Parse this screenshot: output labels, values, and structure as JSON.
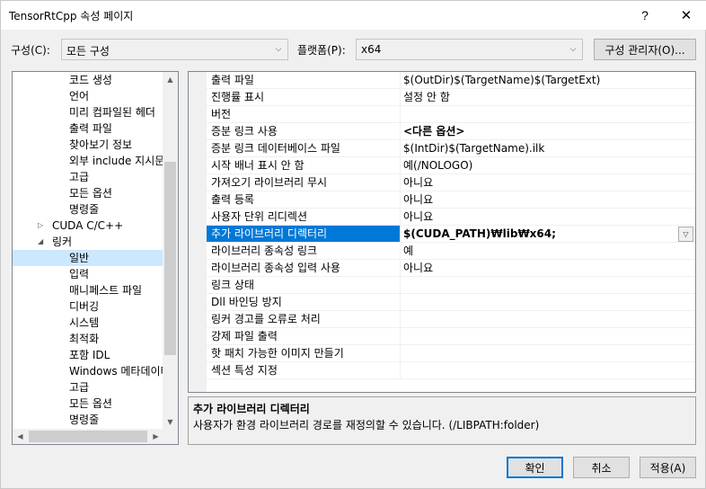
{
  "window": {
    "title": "TensorRtCpp 속성 페이지",
    "help_glyph": "?",
    "close_glyph": "✕"
  },
  "config": {
    "config_label": "구성(C):",
    "config_value": "모든 구성",
    "platform_label": "플랫폼(P):",
    "platform_value": "x64",
    "manager_button": "구성 관리자(O)..."
  },
  "tree": {
    "items": [
      {
        "label": "코드 생성"
      },
      {
        "label": "언어"
      },
      {
        "label": "미리 컴파일된 헤더"
      },
      {
        "label": "출력 파일"
      },
      {
        "label": "찾아보기 정보"
      },
      {
        "label": "외부 include 지시문"
      },
      {
        "label": "고급"
      },
      {
        "label": "모든 옵션"
      },
      {
        "label": "명령줄"
      },
      {
        "label": "CUDA C/C++"
      },
      {
        "label": "링커"
      },
      {
        "label": "일반"
      },
      {
        "label": "입력"
      },
      {
        "label": "매니페스트 파일"
      },
      {
        "label": "디버깅"
      },
      {
        "label": "시스템"
      },
      {
        "label": "최적화"
      },
      {
        "label": "포함 IDL"
      },
      {
        "label": "Windows 메타데이터"
      },
      {
        "label": "고급"
      },
      {
        "label": "모든 옵션"
      },
      {
        "label": "명령줄"
      }
    ],
    "collapsed_glyph": "▷",
    "expanded_glyph": "◢",
    "scroll_up": "▲",
    "scroll_down": "▼",
    "scroll_left": "◀",
    "scroll_right": "▶"
  },
  "grid": {
    "rows": [
      {
        "name": "출력 파일",
        "value": "$(OutDir)$(TargetName)$(TargetExt)"
      },
      {
        "name": "진행률 표시",
        "value": "설정 안 함"
      },
      {
        "name": "버전",
        "value": ""
      },
      {
        "name": "증분 링크 사용",
        "value": "<다른 옵션>"
      },
      {
        "name": "증분 링크 데이터베이스 파일",
        "value": "$(IntDir)$(TargetName).ilk"
      },
      {
        "name": "시작 배너 표시 안 함",
        "value": "예(/NOLOGO)"
      },
      {
        "name": "가져오기 라이브러리 무시",
        "value": "아니요"
      },
      {
        "name": "출력 등록",
        "value": "아니요"
      },
      {
        "name": "사용자 단위 리디렉션",
        "value": "아니요"
      },
      {
        "name": "추가 라이브러리 디렉터리",
        "value": "$(CUDA_PATH)₩lib₩x64;"
      },
      {
        "name": "라이브러리 종속성 링크",
        "value": "예"
      },
      {
        "name": "라이브러리 종속성 입력 사용",
        "value": "아니요"
      },
      {
        "name": "링크 상태",
        "value": ""
      },
      {
        "name": "Dll 바인딩 방지",
        "value": ""
      },
      {
        "name": "링커 경고를 오류로 처리",
        "value": ""
      },
      {
        "name": "강제 파일 출력",
        "value": ""
      },
      {
        "name": "핫 패치 가능한 이미지 만들기",
        "value": ""
      },
      {
        "name": "섹션 특성 지정",
        "value": ""
      }
    ],
    "dropdown_glyph": "▽"
  },
  "description": {
    "title": "추가 라이브러리 디렉터리",
    "text": "사용자가 환경 라이브러리 경로를 재정의할 수 있습니다. (/LIBPATH:folder)"
  },
  "buttons": {
    "ok": "확인",
    "cancel": "취소",
    "apply": "적용(A)"
  },
  "colors": {
    "selection": "#0078d7",
    "tree_selection": "#cce8ff"
  }
}
